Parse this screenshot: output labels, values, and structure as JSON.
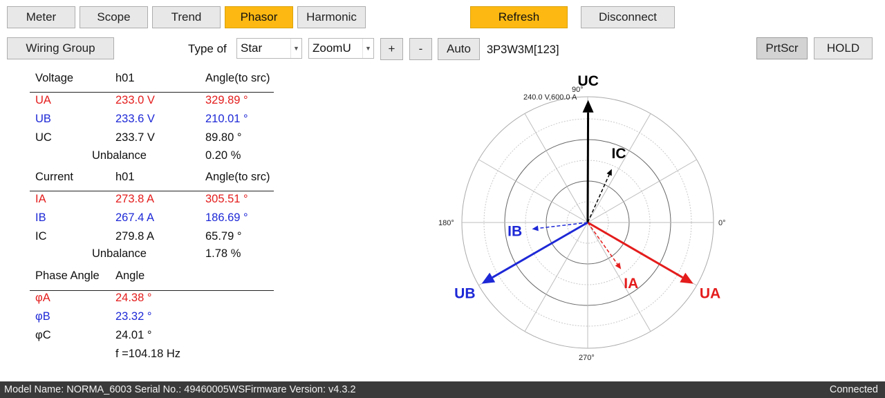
{
  "toolbar": {
    "tabs": [
      {
        "label": "Meter",
        "active": false
      },
      {
        "label": "Scope",
        "active": false
      },
      {
        "label": "Trend",
        "active": false
      },
      {
        "label": "Phasor",
        "active": true
      },
      {
        "label": "Harmonic",
        "active": false
      }
    ],
    "refresh_label": "Refresh",
    "disconnect_label": "Disconnect"
  },
  "controls": {
    "wiring_group_label": "Wiring Group",
    "type_of_label": "Type of",
    "type_select_value": "Star",
    "zoom_select_value": "ZoomU",
    "plus_label": "+",
    "minus_label": "-",
    "auto_label": "Auto",
    "wiring_text": "3P3W3M[123]",
    "prtscr_label": "PrtScr",
    "hold_label": "HOLD"
  },
  "voltage": {
    "header": {
      "c1": "Voltage",
      "c2": "h01",
      "c3": "Angle(to src)"
    },
    "rows": [
      {
        "name": "UA",
        "value": "233.0 V",
        "angle": "329.89 °"
      },
      {
        "name": "UB",
        "value": "233.6 V",
        "angle": "210.01 °"
      },
      {
        "name": "UC",
        "value": "233.7 V",
        "angle": "89.80 °"
      }
    ],
    "unbalance_label": "Unbalance",
    "unbalance_value": "0.20 %"
  },
  "current": {
    "header": {
      "c1": "Current",
      "c2": "h01",
      "c3": "Angle(to src)"
    },
    "rows": [
      {
        "name": "IA",
        "value": "273.8 A",
        "angle": "305.51 °"
      },
      {
        "name": "IB",
        "value": "267.4 A",
        "angle": "186.69 °"
      },
      {
        "name": "IC",
        "value": "279.8 A",
        "angle": "65.79 °"
      }
    ],
    "unbalance_label": "Unbalance",
    "unbalance_value": "1.78 %"
  },
  "phase_angle": {
    "header": {
      "c1": "Phase Angle",
      "c2": "Angle"
    },
    "rows": [
      {
        "name": "φA",
        "value": "24.38 °"
      },
      {
        "name": "φB",
        "value": "23.32 °"
      },
      {
        "name": "φC",
        "value": "24.01 °"
      }
    ],
    "frequency": "f =104.18 Hz"
  },
  "phasor": {
    "scale_label": "240.0 V,600.0 A",
    "axis_labels": {
      "deg0": "0°",
      "deg90": "90°",
      "deg180": "180°",
      "deg270": "270°"
    },
    "colors": {
      "a": "#e41c1c",
      "b": "#1d28d6",
      "c": "#000000",
      "grid": "#9a9a9a"
    },
    "voltage_scale_max": 240.0,
    "current_scale_max": 600.0,
    "voltages": [
      {
        "name": "UA",
        "magnitude": 233.0,
        "angle": 329.89,
        "color": "#e41c1c"
      },
      {
        "name": "UB",
        "magnitude": 233.6,
        "angle": 210.01,
        "color": "#1d28d6"
      },
      {
        "name": "UC",
        "magnitude": 233.7,
        "angle": 89.8,
        "color": "#000000"
      }
    ],
    "currents": [
      {
        "name": "IA",
        "magnitude": 273.8,
        "angle": 305.51,
        "color": "#e41c1c"
      },
      {
        "name": "IB",
        "magnitude": 267.4,
        "angle": 186.69,
        "color": "#1d28d6"
      },
      {
        "name": "IC",
        "magnitude": 279.8,
        "angle": 65.79,
        "color": "#000000"
      }
    ]
  },
  "status": {
    "info": "Model Name:  NORMA_6003 Serial No.:  49460005WSFirmware Version:  v4.3.2",
    "connection": "Connected"
  }
}
